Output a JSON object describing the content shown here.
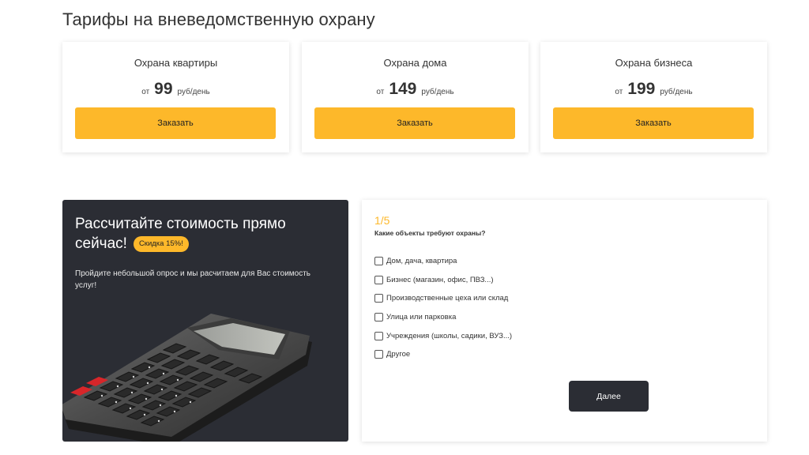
{
  "page_title": "Тарифы на вневедомственную охрану",
  "tariffs": [
    {
      "name": "Охрана квартиры",
      "from": "от",
      "amount": "99",
      "unit": "руб/день",
      "button": "Заказать"
    },
    {
      "name": "Охрана дома",
      "from": "от",
      "amount": "149",
      "unit": "руб/день",
      "button": "Заказать"
    },
    {
      "name": "Охрана бизнеса",
      "from": "от",
      "amount": "199",
      "unit": "руб/день",
      "button": "Заказать"
    }
  ],
  "promo": {
    "title": "Рассчитайте стоимость прямо сейчас!",
    "badge": "Скидка 15%!",
    "text": "Пройдите небольшой опрос и мы расчитаем для Вас стоимость услуг!"
  },
  "quiz": {
    "step": "1/5",
    "question": "Какие объекты требуют охраны?",
    "options": [
      "Дом, дача, квартира",
      "Бизнес (магазин, офис, ПВЗ...)",
      "Производственные цеха или склад",
      "Улица или парковка",
      "Учреждения (школы, садики, ВУЗ...)",
      "Другое"
    ],
    "next_button": "Далее"
  },
  "colors": {
    "accent": "#fdb82a",
    "dark_panel": "#2b2d34"
  }
}
